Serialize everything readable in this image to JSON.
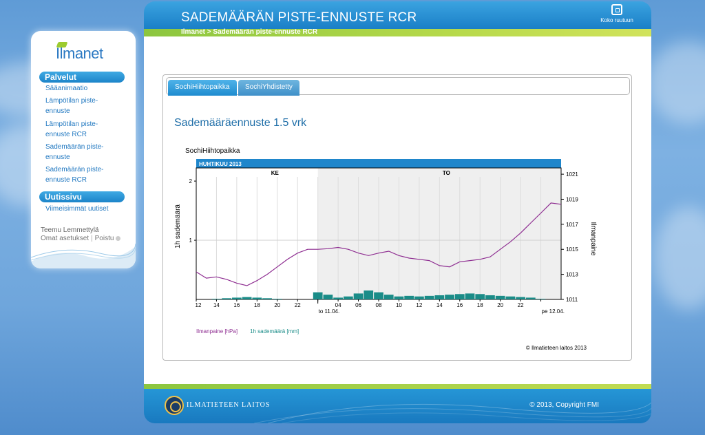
{
  "header": {
    "title": "SADEMÄÄRÄN PISTE-ENNUSTE RCR",
    "fullscreen_label": "Koko ruutuun",
    "breadcrumb": "Ilmanet > Sademäärän piste-ennuste RCR"
  },
  "sidebar": {
    "logo": "Ilmanet",
    "services_title": "Palvelut",
    "services": [
      {
        "label": "Sääanimaatio"
      },
      {
        "label": "Lämpötilan piste-ennuste"
      },
      {
        "label": "Lämpötilan piste-ennuste RCR"
      },
      {
        "label": "Sademäärän piste-ennuste"
      },
      {
        "label": "Sademäärän piste-ennuste RCR"
      }
    ],
    "news_title": "Uutissivu",
    "news": [
      {
        "label": "Viimeisimmät uutiset"
      }
    ],
    "user": {
      "name": "Teemu Lemmettylä",
      "settings": "Omat asetukset",
      "separator": "|",
      "logout": "Poistu"
    }
  },
  "tabs": [
    {
      "label": "SochiHiihtopaikka",
      "active": true
    },
    {
      "label": "SochiYhdistetty",
      "active": false
    }
  ],
  "chart_heading": "Sademääräennuste 1.5 vrk",
  "chart_data": {
    "type": "line",
    "title": "SochiHiihtopaikka",
    "month_label": "HUHTIKUU 2013",
    "day_labels": [
      "KE",
      "TO"
    ],
    "x_ticks": [
      "12",
      "14",
      "16",
      "18",
      "20",
      "22",
      "to 11.04.",
      "04",
      "06",
      "08",
      "10",
      "12",
      "14",
      "16",
      "18",
      "20",
      "22",
      "pe 12.04."
    ],
    "ylabel_left": "1h sademäärä",
    "ylabel_right": "Ilmanpaine",
    "y_left_ticks": [
      "2",
      "1"
    ],
    "y_right_ticks": [
      "1021",
      "1019",
      "1017",
      "1015",
      "1013",
      "1011"
    ],
    "ylim_left": [
      0,
      2
    ],
    "ylim_right": [
      1011,
      1021.5
    ],
    "hours": [
      12,
      13,
      14,
      15,
      16,
      17,
      18,
      19,
      20,
      21,
      22,
      23,
      24,
      25,
      26,
      27,
      28,
      29,
      30,
      31,
      32,
      33,
      34,
      35,
      36,
      37,
      38,
      39,
      40,
      41,
      42,
      43,
      44,
      45,
      46,
      47,
      48
    ],
    "series": [
      {
        "name": "Ilmanpaine [hPa]",
        "color": "#8e2d91",
        "values": [
          1013.2,
          1012.7,
          1012.8,
          1012.6,
          1012.3,
          1012.1,
          1012.5,
          1013.0,
          1013.6,
          1014.2,
          1014.7,
          1015.0,
          1015.0,
          1015.05,
          1015.15,
          1015.0,
          1014.7,
          1014.5,
          1014.7,
          1014.85,
          1014.5,
          1014.3,
          1014.2,
          1014.1,
          1013.7,
          1013.6,
          1014.0,
          1014.1,
          1014.2,
          1014.4,
          1015.0,
          1015.6,
          1016.3,
          1017.1,
          1017.9,
          1018.7,
          1018.6
        ]
      },
      {
        "name": "1h sademäärä [mm]",
        "color": "#1a8c88",
        "values": [
          0.0,
          0.0,
          0.01,
          0.02,
          0.03,
          0.04,
          0.03,
          0.02,
          0.01,
          0.0,
          0.0,
          0.0,
          0.12,
          0.08,
          0.03,
          0.05,
          0.1,
          0.15,
          0.12,
          0.08,
          0.05,
          0.06,
          0.05,
          0.06,
          0.07,
          0.08,
          0.09,
          0.1,
          0.09,
          0.07,
          0.06,
          0.05,
          0.04,
          0.03,
          0.01,
          0.0,
          0.0
        ]
      }
    ],
    "credit": "© Ilmatieteen laitos 2013"
  },
  "footer": {
    "org": "ILMATIETEEN LAITOS",
    "copyright": "© 2013, Copyright FMI"
  }
}
